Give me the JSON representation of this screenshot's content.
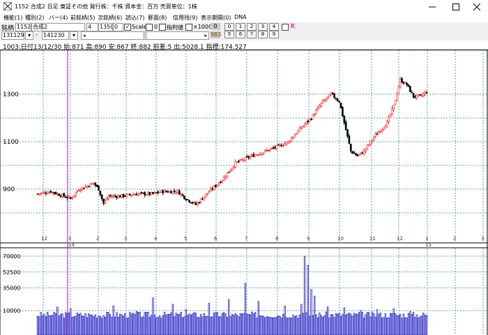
{
  "window": {
    "title": "1152 合成2 日足 東証その他 発行株：千株 資本金：百万 売買単位：1株"
  },
  "menu": [
    "機能(1)",
    "種別(2)",
    "バー(4)",
    "前銘柄(5)",
    "次銘柄(6)",
    "読込(7)",
    "罫面(8)",
    "信用残(9)",
    "表示期間(0)",
    "DNA"
  ],
  "toolbar": {
    "code_label": "銘柄",
    "code": "1152",
    "name": "合成2",
    "field_a": "4",
    "field_b": "1350",
    "field_c": "0",
    "scale_label": "Scale",
    "zero": "0",
    "index_label": "指判値",
    "x1000_label": "×1000",
    "value_a": "0",
    "value_b": "983",
    "nums_top": [
      "0",
      "1",
      "2",
      "3",
      "4"
    ],
    "nums_bot": [
      "5",
      "6",
      "7",
      "8",
      "9"
    ],
    "r_label": "R",
    "date_from": "131129",
    "date_to": "141230"
  },
  "info": "1003:日付13/12/30 始:871 高:890 安:867 終:882 前差:5 出:5028.1 指標:174.527",
  "chart_data": [
    {
      "type": "candlestick",
      "ytick_labels": [
        "900",
        "1100",
        "1300"
      ],
      "ylim": [
        780,
        1410
      ],
      "xtick_labels": [
        "12",
        "1",
        "2",
        "3",
        "4",
        "5",
        "6",
        "7",
        "8",
        "9",
        "10",
        "11",
        "12",
        "1",
        "2",
        "3"
      ],
      "year_labels": [
        "14",
        "15"
      ],
      "close_path": [
        [
          0,
          880
        ],
        [
          8,
          890
        ],
        [
          16,
          870
        ],
        [
          20,
          860
        ],
        [
          25,
          900
        ],
        [
          34,
          925
        ],
        [
          37,
          900
        ],
        [
          40,
          840
        ],
        [
          43,
          870
        ],
        [
          50,
          870
        ],
        [
          60,
          880
        ],
        [
          70,
          880
        ],
        [
          75,
          890
        ],
        [
          85,
          890
        ],
        [
          90,
          860
        ],
        [
          96,
          835
        ],
        [
          104,
          890
        ],
        [
          112,
          940
        ],
        [
          120,
          1010
        ],
        [
          130,
          1040
        ],
        [
          138,
          1060
        ],
        [
          146,
          1080
        ],
        [
          152,
          1100
        ],
        [
          160,
          1160
        ],
        [
          166,
          1200
        ],
        [
          172,
          1260
        ],
        [
          178,
          1300
        ],
        [
          183,
          1270
        ],
        [
          186,
          1180
        ],
        [
          190,
          1060
        ],
        [
          194,
          1040
        ],
        [
          198,
          1060
        ],
        [
          204,
          1120
        ],
        [
          208,
          1150
        ],
        [
          212,
          1180
        ],
        [
          216,
          1250
        ],
        [
          220,
          1360
        ],
        [
          224,
          1340
        ],
        [
          228,
          1290
        ],
        [
          232,
          1290
        ],
        [
          236,
          1310
        ]
      ],
      "series_total": 236
    },
    {
      "type": "bar",
      "ytick_labels": [
        "10000",
        "35000",
        "52500",
        "70000"
      ],
      "ylim": [
        0,
        75000
      ],
      "spikes": [
        [
          12,
          14000
        ],
        [
          20,
          12000
        ],
        [
          46,
          15000
        ],
        [
          60,
          9000
        ],
        [
          70,
          24000
        ],
        [
          82,
          17000
        ],
        [
          90,
          11000
        ],
        [
          104,
          18000
        ],
        [
          116,
          22000
        ],
        [
          126,
          40000
        ],
        [
          134,
          20000
        ],
        [
          150,
          15000
        ],
        [
          160,
          17000
        ],
        [
          162,
          70000
        ],
        [
          164,
          60000
        ],
        [
          166,
          33000
        ],
        [
          168,
          26000
        ],
        [
          176,
          14000
        ],
        [
          186,
          13000
        ],
        [
          196,
          10000
        ],
        [
          206,
          11000
        ],
        [
          216,
          12000
        ],
        [
          226,
          9000
        ]
      ]
    }
  ]
}
